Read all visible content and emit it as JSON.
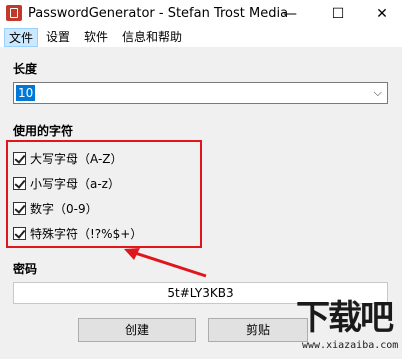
{
  "window": {
    "title": "PasswordGenerator - Stefan Trost Media",
    "minimize": "—",
    "maximize": "☐",
    "close": "✕"
  },
  "menu": {
    "file": "文件",
    "settings": "设置",
    "software": "软件",
    "info": "信息和帮助"
  },
  "length": {
    "label": "长度",
    "value": "10"
  },
  "characters": {
    "label": "使用的字符",
    "options": [
      {
        "label": "大写字母（A-Z）",
        "checked": true
      },
      {
        "label": "小写字母（a-z）",
        "checked": true
      },
      {
        "label": "数字（0-9）",
        "checked": true
      },
      {
        "label": "特殊字符（!?%$+）",
        "checked": true
      }
    ]
  },
  "password": {
    "label": "密码",
    "value": "5t#LY3KB3"
  },
  "buttons": {
    "create": "创建",
    "clipboard": "剪贴"
  },
  "watermark": {
    "main": "下载吧",
    "sub": "www.xiazaiba.com"
  },
  "colors": {
    "highlight_box": "#e0161c",
    "selection": "#0078d7"
  }
}
